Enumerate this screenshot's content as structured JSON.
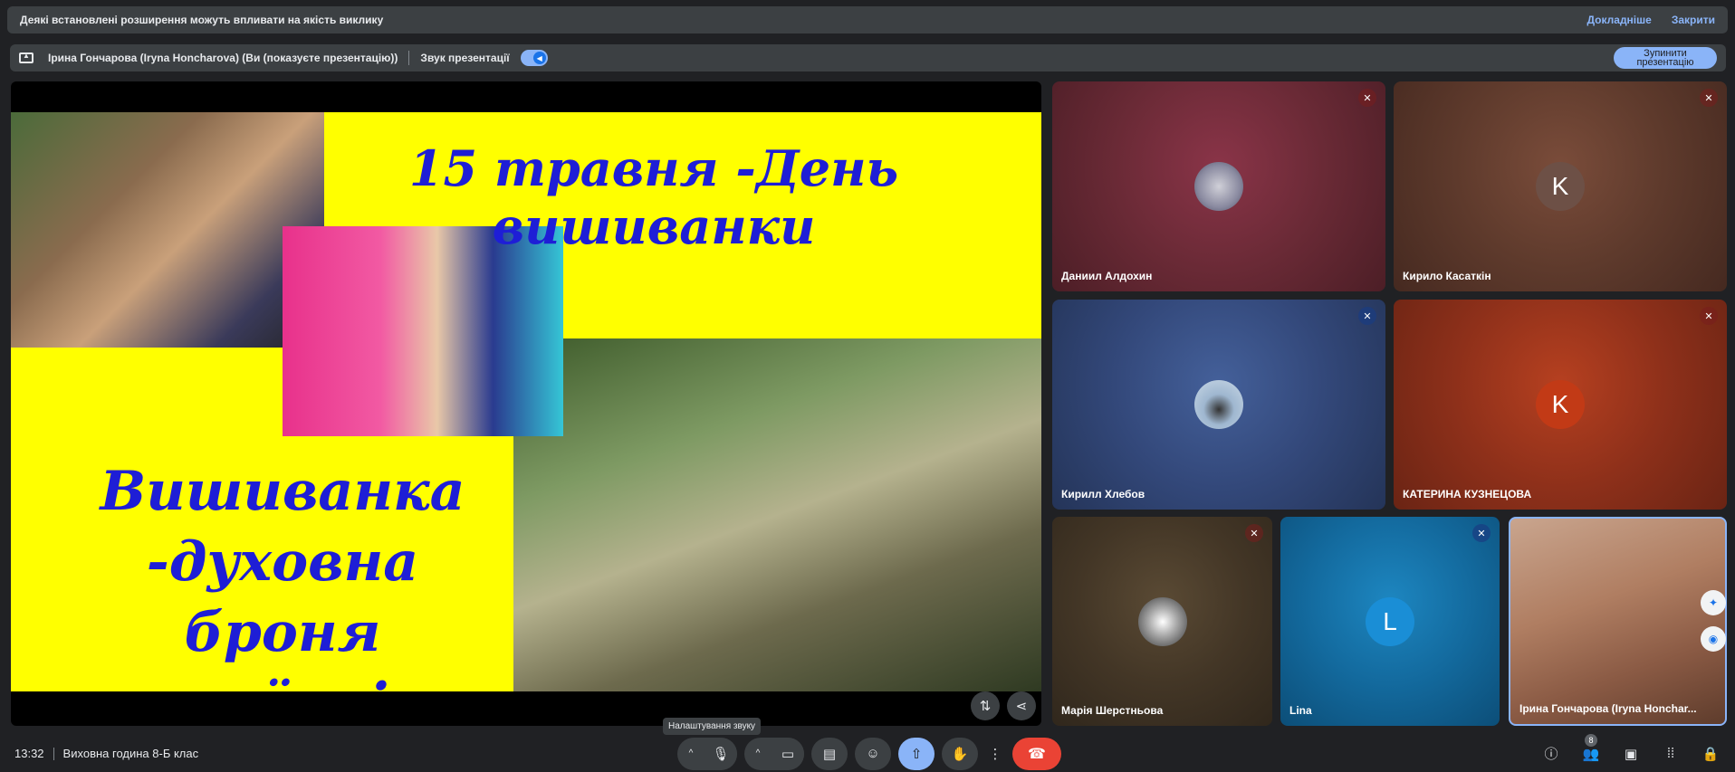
{
  "banner": {
    "message": "Деякі встановлені розширення можуть впливати на якість виклику",
    "learn_more": "Докладніше",
    "close": "Закрити"
  },
  "presentation_bar": {
    "presenter": "Ірина Гончарова (Iryna Honcharova) (Ви (показуєте презентацію))",
    "sound_label": "Звук презентації",
    "sound_on": true,
    "stop_button": "Зупинити презентацію"
  },
  "slide": {
    "title": "15 травня -День вишиванки",
    "subtitle_line1": "Вишиванка",
    "subtitle_line2": "-духовна броня",
    "subtitle_line3": "українців."
  },
  "participants": [
    {
      "name": "Даниил Алдохин",
      "muted": true
    },
    {
      "name": "Кирило Касаткін",
      "muted": true,
      "initial": "K"
    },
    {
      "name": "Кирилл Хлебов",
      "muted": true
    },
    {
      "name": "КАТЕРИНА КУЗНЕЦОВА",
      "muted": true,
      "initial": "K"
    },
    {
      "name": "Марія Шерстньова",
      "muted": true
    },
    {
      "name": "Lina",
      "muted": true,
      "initial": "L"
    },
    {
      "name": "Ірина Гончарова (Iryna Honchar..."
    }
  ],
  "bottom": {
    "time": "13:32",
    "meeting_title": "Виховна година 8-Б клас",
    "tooltip": "Налаштування звуку",
    "people_count": "8"
  },
  "colors": {
    "accent": "#8ab4f8",
    "hangup": "#ea4335",
    "slide_bg": "#ffff00",
    "slide_text": "#1e1ed6"
  }
}
